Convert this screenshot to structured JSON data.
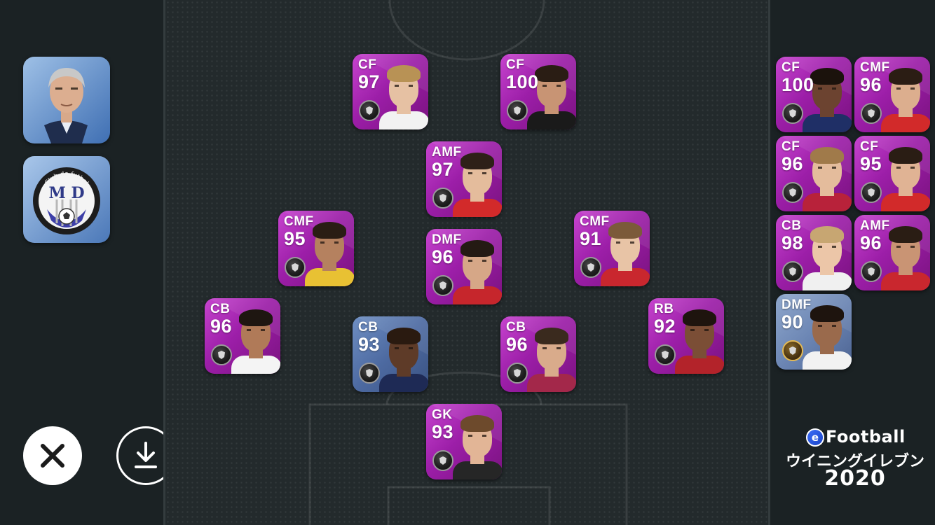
{
  "manager": {
    "icon": "manager-portrait"
  },
  "club": {
    "name_arc": "Club de futbol",
    "initials": "M D",
    "icon": "club-crest"
  },
  "actions": {
    "close_icon": "close-icon",
    "download_icon": "download-icon"
  },
  "brand": {
    "e_letter": "e",
    "name": "Football",
    "subtitle": "ウイニングイレブン",
    "year": "2020"
  },
  "lineup": [
    {
      "pos": "CF",
      "rating": "97"
    },
    {
      "pos": "CF",
      "rating": "100"
    },
    {
      "pos": "AMF",
      "rating": "97"
    },
    {
      "pos": "CMF",
      "rating": "95"
    },
    {
      "pos": "DMF",
      "rating": "96"
    },
    {
      "pos": "CMF",
      "rating": "91"
    },
    {
      "pos": "CB",
      "rating": "96"
    },
    {
      "pos": "CB",
      "rating": "93"
    },
    {
      "pos": "CB",
      "rating": "96"
    },
    {
      "pos": "RB",
      "rating": "92"
    },
    {
      "pos": "GK",
      "rating": "93"
    }
  ],
  "substitutes": [
    {
      "pos": "CF",
      "rating": "100"
    },
    {
      "pos": "CMF",
      "rating": "96"
    },
    {
      "pos": "CF",
      "rating": "96"
    },
    {
      "pos": "CF",
      "rating": "95"
    },
    {
      "pos": "CB",
      "rating": "98"
    },
    {
      "pos": "AMF",
      "rating": "96"
    },
    {
      "pos": "DMF",
      "rating": "90"
    }
  ],
  "colors": {
    "card_featured": "#b22fbc",
    "card_standard": "#4d6aa1",
    "background": "#1b2224",
    "pitch": "#232a2c"
  }
}
